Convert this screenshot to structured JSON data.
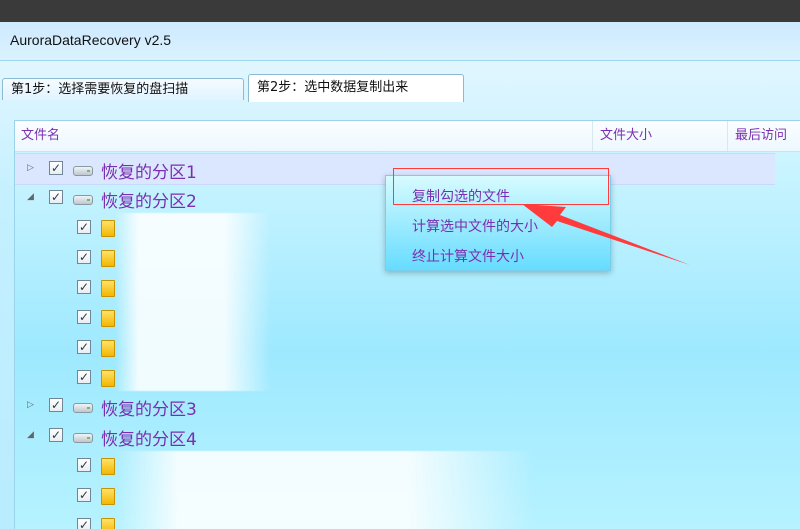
{
  "window": {
    "title": "AuroraDataRecovery v2.5"
  },
  "tabs": [
    {
      "label": "第1步：选择需要恢复的盘扫描"
    },
    {
      "label": "第2步：选中数据复制出来"
    }
  ],
  "columns": [
    "文件名",
    "文件大小",
    "最后访问"
  ],
  "tree": {
    "partitions": [
      {
        "label": "恢复的分区1",
        "expanded": false,
        "checked": true
      },
      {
        "label": "恢复的分区2",
        "expanded": true,
        "checked": true,
        "child_count": 6
      },
      {
        "label": "恢复的分区3",
        "expanded": false,
        "checked": true
      },
      {
        "label": "恢复的分区4",
        "expanded": true,
        "checked": true,
        "child_count": 3
      }
    ]
  },
  "context_menu": {
    "items": [
      {
        "label": "复制勾选的文件"
      },
      {
        "label": "计算选中文件的大小"
      },
      {
        "label": "终止计算文件大小"
      }
    ]
  },
  "colors": {
    "text_purple": "#7a2fb0",
    "annotation_red": "#ff3b3b"
  }
}
